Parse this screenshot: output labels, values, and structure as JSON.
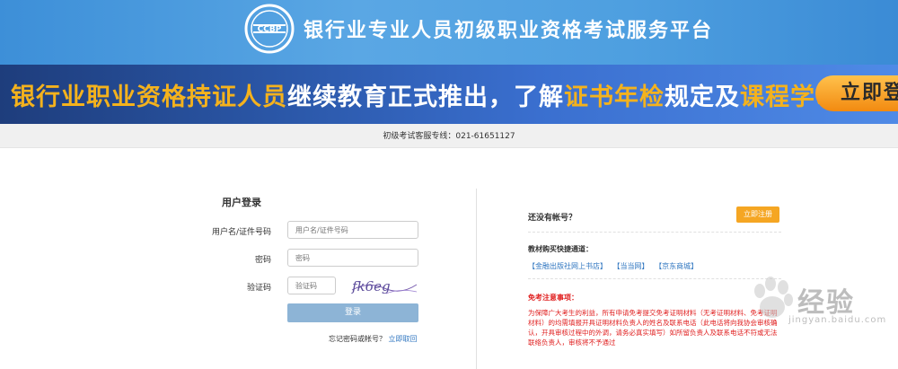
{
  "header": {
    "logo_text": "CCBP",
    "title": "银行业专业人员初级职业资格考试服务平台"
  },
  "banner": {
    "part1": "银行业职业资格持证人员",
    "part2": "继续教育正式推出，了解",
    "part3": "证书年检",
    "part4": "规定及",
    "part5": "课程学习",
    "button": "立即登"
  },
  "hotline": "初级考试客服专线：021-61651127",
  "login": {
    "title": "用户登录",
    "username_label": "用户名/证件号码",
    "username_placeholder": "用户名/证件号码",
    "password_label": "密码",
    "password_placeholder": "密码",
    "captcha_label": "验证码",
    "captcha_placeholder": "验证码",
    "captcha_image_text": "fk6eg",
    "submit": "登录",
    "forgot_text": "忘记密码或帐号？",
    "forgot_link": "立即取回"
  },
  "register": {
    "question": "还没有帐号？",
    "button": "立即注册"
  },
  "channels": {
    "title": "教材购买快捷通道：",
    "links": [
      "【金融出版社网上书店】",
      "【当当网】",
      "【京东商城】"
    ]
  },
  "notice": {
    "title": "免考注意事项：",
    "body": "为保障广大考生的利益，所有申请免考提交免考证明材料（无考证明材料、免考证明材料）的均需填报开具证明材料负责人的姓名及联系电话（此电话将向我协会审核确认，开具审核过程中的外调，请务必真实填写）如所留负责人及联系电话不符或无法联络负责人，审核将不予通过"
  },
  "watermark": {
    "text": "经验",
    "url": "jingyan.baidu.com"
  },
  "colors": {
    "header_blue": "#4e9fe0",
    "banner_blue": "#2a56a6",
    "highlight_yellow": "#f4b21d",
    "register_orange": "#f5a623",
    "login_button": "#8db4d6",
    "link_blue": "#2f76c0",
    "notice_red": "#e02020"
  }
}
